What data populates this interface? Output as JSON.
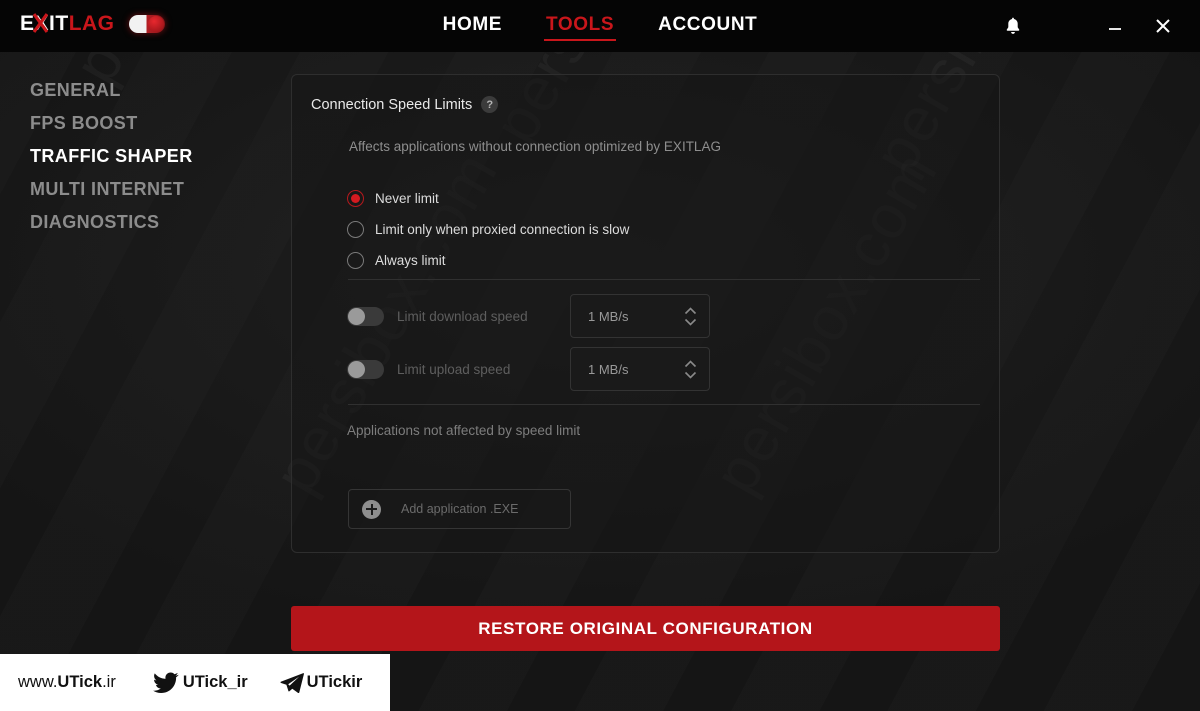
{
  "titlebar": {
    "logo": {
      "white_part": "E",
      "mid_part": "XIT",
      "red_part": "LAG",
      "x_icon": "x-slash-icon"
    },
    "power_toggle": {
      "name": "power-toggle",
      "state": "on"
    },
    "nav": [
      {
        "label": "HOME",
        "active": false
      },
      {
        "label": "TOOLS",
        "active": true
      },
      {
        "label": "ACCOUNT",
        "active": false
      }
    ],
    "controls": {
      "bell": "notification-bell-icon",
      "minimize": "minimize-icon",
      "close": "close-icon"
    }
  },
  "sidebar": {
    "items": [
      {
        "label": "GENERAL",
        "active": false
      },
      {
        "label": "FPS BOOST",
        "active": false
      },
      {
        "label": "TRAFFIC SHAPER",
        "active": true
      },
      {
        "label": "MULTI INTERNET",
        "active": false
      },
      {
        "label": "DIAGNOSTICS",
        "active": false
      }
    ]
  },
  "card": {
    "title": "Connection Speed Limits",
    "help_icon": "?",
    "subtitle": "Affects applications without connection optimized by EXITLAG",
    "radios": [
      {
        "label": "Never limit",
        "selected": true
      },
      {
        "label": "Limit only when proxied connection is slow",
        "selected": false
      },
      {
        "label": "Always limit",
        "selected": false
      }
    ],
    "limits": [
      {
        "label": "Limit download speed",
        "enabled": false,
        "value": "1 MB/s"
      },
      {
        "label": "Limit upload speed",
        "enabled": false,
        "value": "1 MB/s"
      }
    ],
    "apps_label": "Applications not affected by speed limit",
    "add_app": {
      "text": "Add application .EXE",
      "icon": "plus-circle-icon"
    }
  },
  "restore_button": {
    "label": "RESTORE ORIGINAL CONFIGURATION"
  },
  "watermark_bar": {
    "site_prefix": "www.",
    "site_bold": "UTick",
    "site_suffix": ".ir",
    "twitter_handle": "UTick_ir",
    "telegram_handle": "UTickir"
  },
  "background_watermark": "persibox.com",
  "colors": {
    "accent_red": "#c9161b",
    "button_red": "#b4151a",
    "bg_dark": "#151515",
    "titlebar": "#050505"
  }
}
